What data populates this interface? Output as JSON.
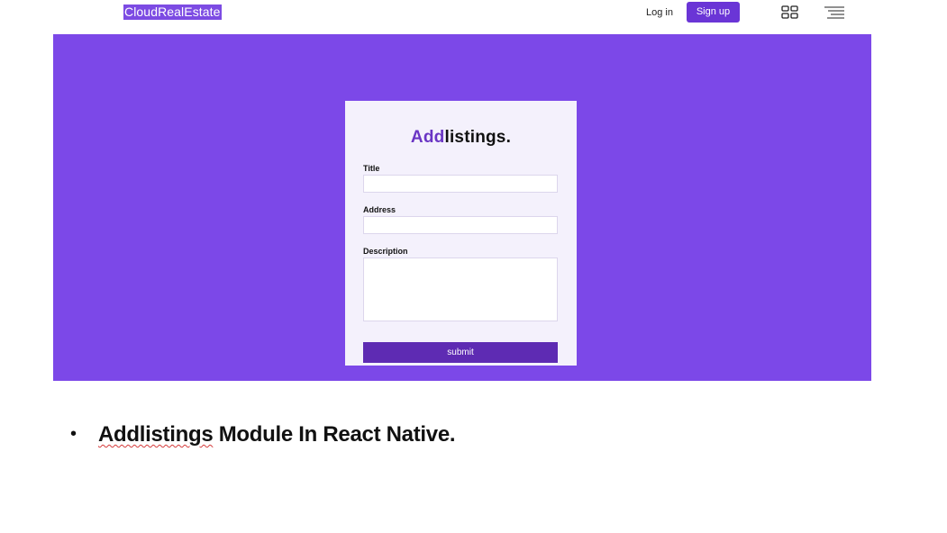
{
  "header": {
    "brand": "CloudRealEstate",
    "login_label": "Log in",
    "signup_label": "Sign up",
    "grid_icon": "grid-icon",
    "menu_icon": "hamburger-menu-icon"
  },
  "form": {
    "title_accent": "Add",
    "title_rest": "listings.",
    "fields": [
      {
        "label": "Title",
        "value": "",
        "placeholder": ""
      },
      {
        "label": "Address",
        "value": "",
        "placeholder": ""
      },
      {
        "label": "Description",
        "value": "",
        "placeholder": ""
      }
    ],
    "submit_label": "submit"
  },
  "caption": {
    "bullet": "•",
    "highlight": "Addlistings",
    "rest": " Module In React Native."
  },
  "colors": {
    "hero_bg": "#7c48e8",
    "brand_bg": "#7c4be3",
    "button_bg": "#6a35d6",
    "submit_bg": "#5e2bb3",
    "title_accent": "#6a35c4"
  }
}
